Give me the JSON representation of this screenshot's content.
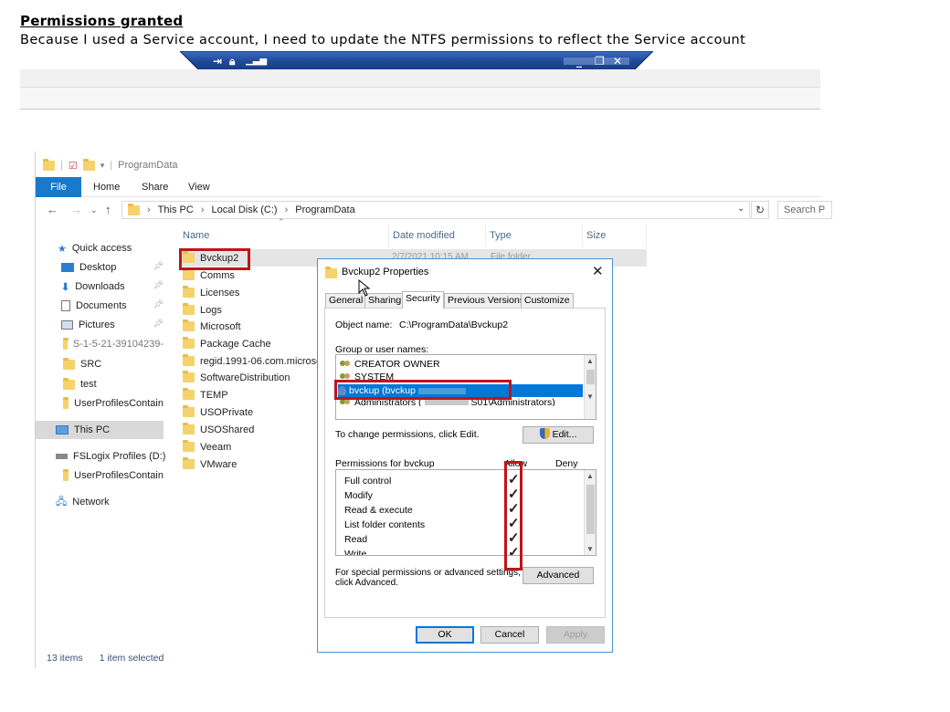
{
  "document": {
    "title": "Permissions granted",
    "text": "Because I used a Service account, I need to update the NTFS permissions to reflect the Service account"
  },
  "rdp_bar": {
    "icons": [
      "pin-icon",
      "lock-icon",
      "signal-icon"
    ],
    "controls": {
      "minimize": "_",
      "restore": "❐",
      "close": "✕"
    }
  },
  "explorer": {
    "window_title": "ProgramData",
    "ribbon_tabs": [
      "File",
      "Home",
      "Share",
      "View"
    ],
    "breadcrumb": [
      "This PC",
      "Local Disk (C:)",
      "ProgramData"
    ],
    "search_placeholder": "Search P",
    "nav": {
      "quick_access": "Quick access",
      "desktop": "Desktop",
      "downloads": "Downloads",
      "documents": "Documents",
      "pictures": "Pictures",
      "sid_folder": "S-1-5-21-39104239-",
      "src": "SRC",
      "test": "test",
      "user_profiles_1": "UserProfilesContain",
      "this_pc": "This PC",
      "fslogix": "FSLogix Profiles (D:)",
      "user_profiles_2": "UserProfilesContain",
      "network": "Network"
    },
    "columns": {
      "name": "Name",
      "date": "Date modified",
      "type": "Type",
      "size": "Size"
    },
    "selected_row": {
      "date": "2/7/2021 10:15 AM",
      "type": "File folder"
    },
    "files": [
      "Bvckup2",
      "Comms",
      "Licenses",
      "Logs",
      "Microsoft",
      "Package Cache",
      "regid.1991-06.com.microsof",
      "SoftwareDistribution",
      "TEMP",
      "USOPrivate",
      "USOShared",
      "Veeam",
      "VMware"
    ],
    "status": {
      "count": "13 items",
      "selected": "1 item selected"
    }
  },
  "dialog": {
    "title": "Bvckup2 Properties",
    "tabs": [
      "General",
      "Sharing",
      "Security",
      "Previous Versions",
      "Customize"
    ],
    "active_tab": "Security",
    "object_name_label": "Object name:",
    "object_name_value": "C:\\ProgramData\\Bvckup2",
    "group_label": "Group or user names:",
    "users": [
      "CREATOR OWNER",
      "SYSTEM",
      "bvckup (bvckup",
      "Administrators ("
    ],
    "admin_suffix": "S01\\Administrators)",
    "change_hint": "To change permissions, click Edit.",
    "edit_button": "Edit...",
    "perm_label": "Permissions for bvckup",
    "allow_label": "Allow",
    "deny_label": "Deny",
    "permissions": [
      "Full control",
      "Modify",
      "Read & execute",
      "List folder contents",
      "Read",
      "Write"
    ],
    "allowed": [
      true,
      true,
      true,
      true,
      true,
      true
    ],
    "special_hint_1": "For special permissions or advanced settings,",
    "special_hint_2": "click Advanced.",
    "advanced_button": "Advanced",
    "ok_button": "OK",
    "cancel_button": "Cancel",
    "apply_button": "Apply"
  },
  "colors": {
    "accent": "#0078d7",
    "highlight": "#c0141b",
    "folder": "#f5d26b",
    "rdp_bar": "#1f4a9a"
  }
}
